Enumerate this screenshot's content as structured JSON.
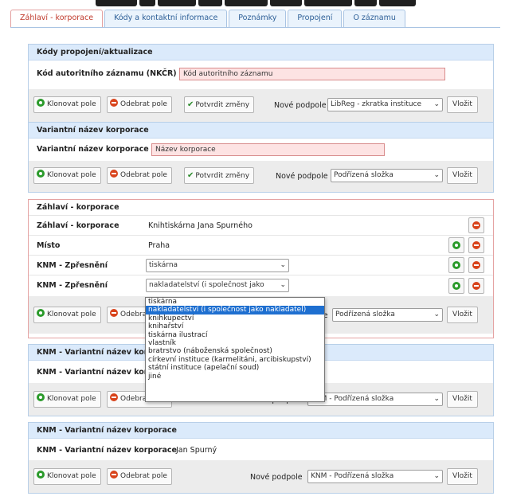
{
  "tabs": [
    {
      "label": "Záhlaví - korporace",
      "active": true
    },
    {
      "label": "Kódy a kontaktní informace",
      "active": false
    },
    {
      "label": "Poznámky",
      "active": false
    },
    {
      "label": "Propojení",
      "active": false
    },
    {
      "label": "O záznamu",
      "active": false
    }
  ],
  "common": {
    "clone": "Klonovat pole",
    "remove": "Odebrat pole",
    "confirm": "Potvrdit změny",
    "new_subfield": "Nové podpole",
    "insert": "Vložit"
  },
  "panel1": {
    "header": "Kódy propojení/aktualizace",
    "field_label": "Kód autoritního záznamu (NKČR)",
    "field_placeholder": "Kód autoritního záznamu",
    "subfield_select": "LibReg - zkratka instituce"
  },
  "panel2": {
    "header": "Variantní název korporace",
    "field_label": "Variantní název korporace",
    "field_placeholder": "Název korporace",
    "subfield_select": "Podřízená složka"
  },
  "panel3": {
    "header": "Záhlaví - korporace",
    "rows": [
      {
        "label": "Záhlaví - korporace",
        "value": "Knihtiskárna Jana Spurného"
      },
      {
        "label": "Místo",
        "value": "Praha"
      },
      {
        "label": "KNM - Zpřesnění",
        "value": "tiskárna"
      },
      {
        "label": "KNM - Zpřesnění",
        "value": "nakladatelství (i společnost jako"
      }
    ],
    "subfield_select": "Podřízená složka"
  },
  "dropdown": {
    "options": [
      "tiskárna",
      "nakladatelství (i společnost jako nakladatel)",
      "knihkupectví",
      "knihařství",
      "tiskárna ilustrací",
      "vlastník",
      "bratrstvo (náboženská společnost)",
      "církevní instituce (karmelitáni, arcibiskupství)",
      "státní instituce (apelační soud)",
      "jiné"
    ],
    "selected_index": 1
  },
  "panel4": {
    "header": "KNM - Variantní název korporace",
    "row_label": "KNM - Variantní název korporace",
    "row_value": "",
    "subfield_select": "KNM - Podřízená složka"
  },
  "panel5": {
    "header": "KNM - Variantní název korporace",
    "row_label": "KNM - Variantní název korporace",
    "row_value": "Jan Spurný",
    "subfield_select": "KNM - Podřízená složka"
  }
}
